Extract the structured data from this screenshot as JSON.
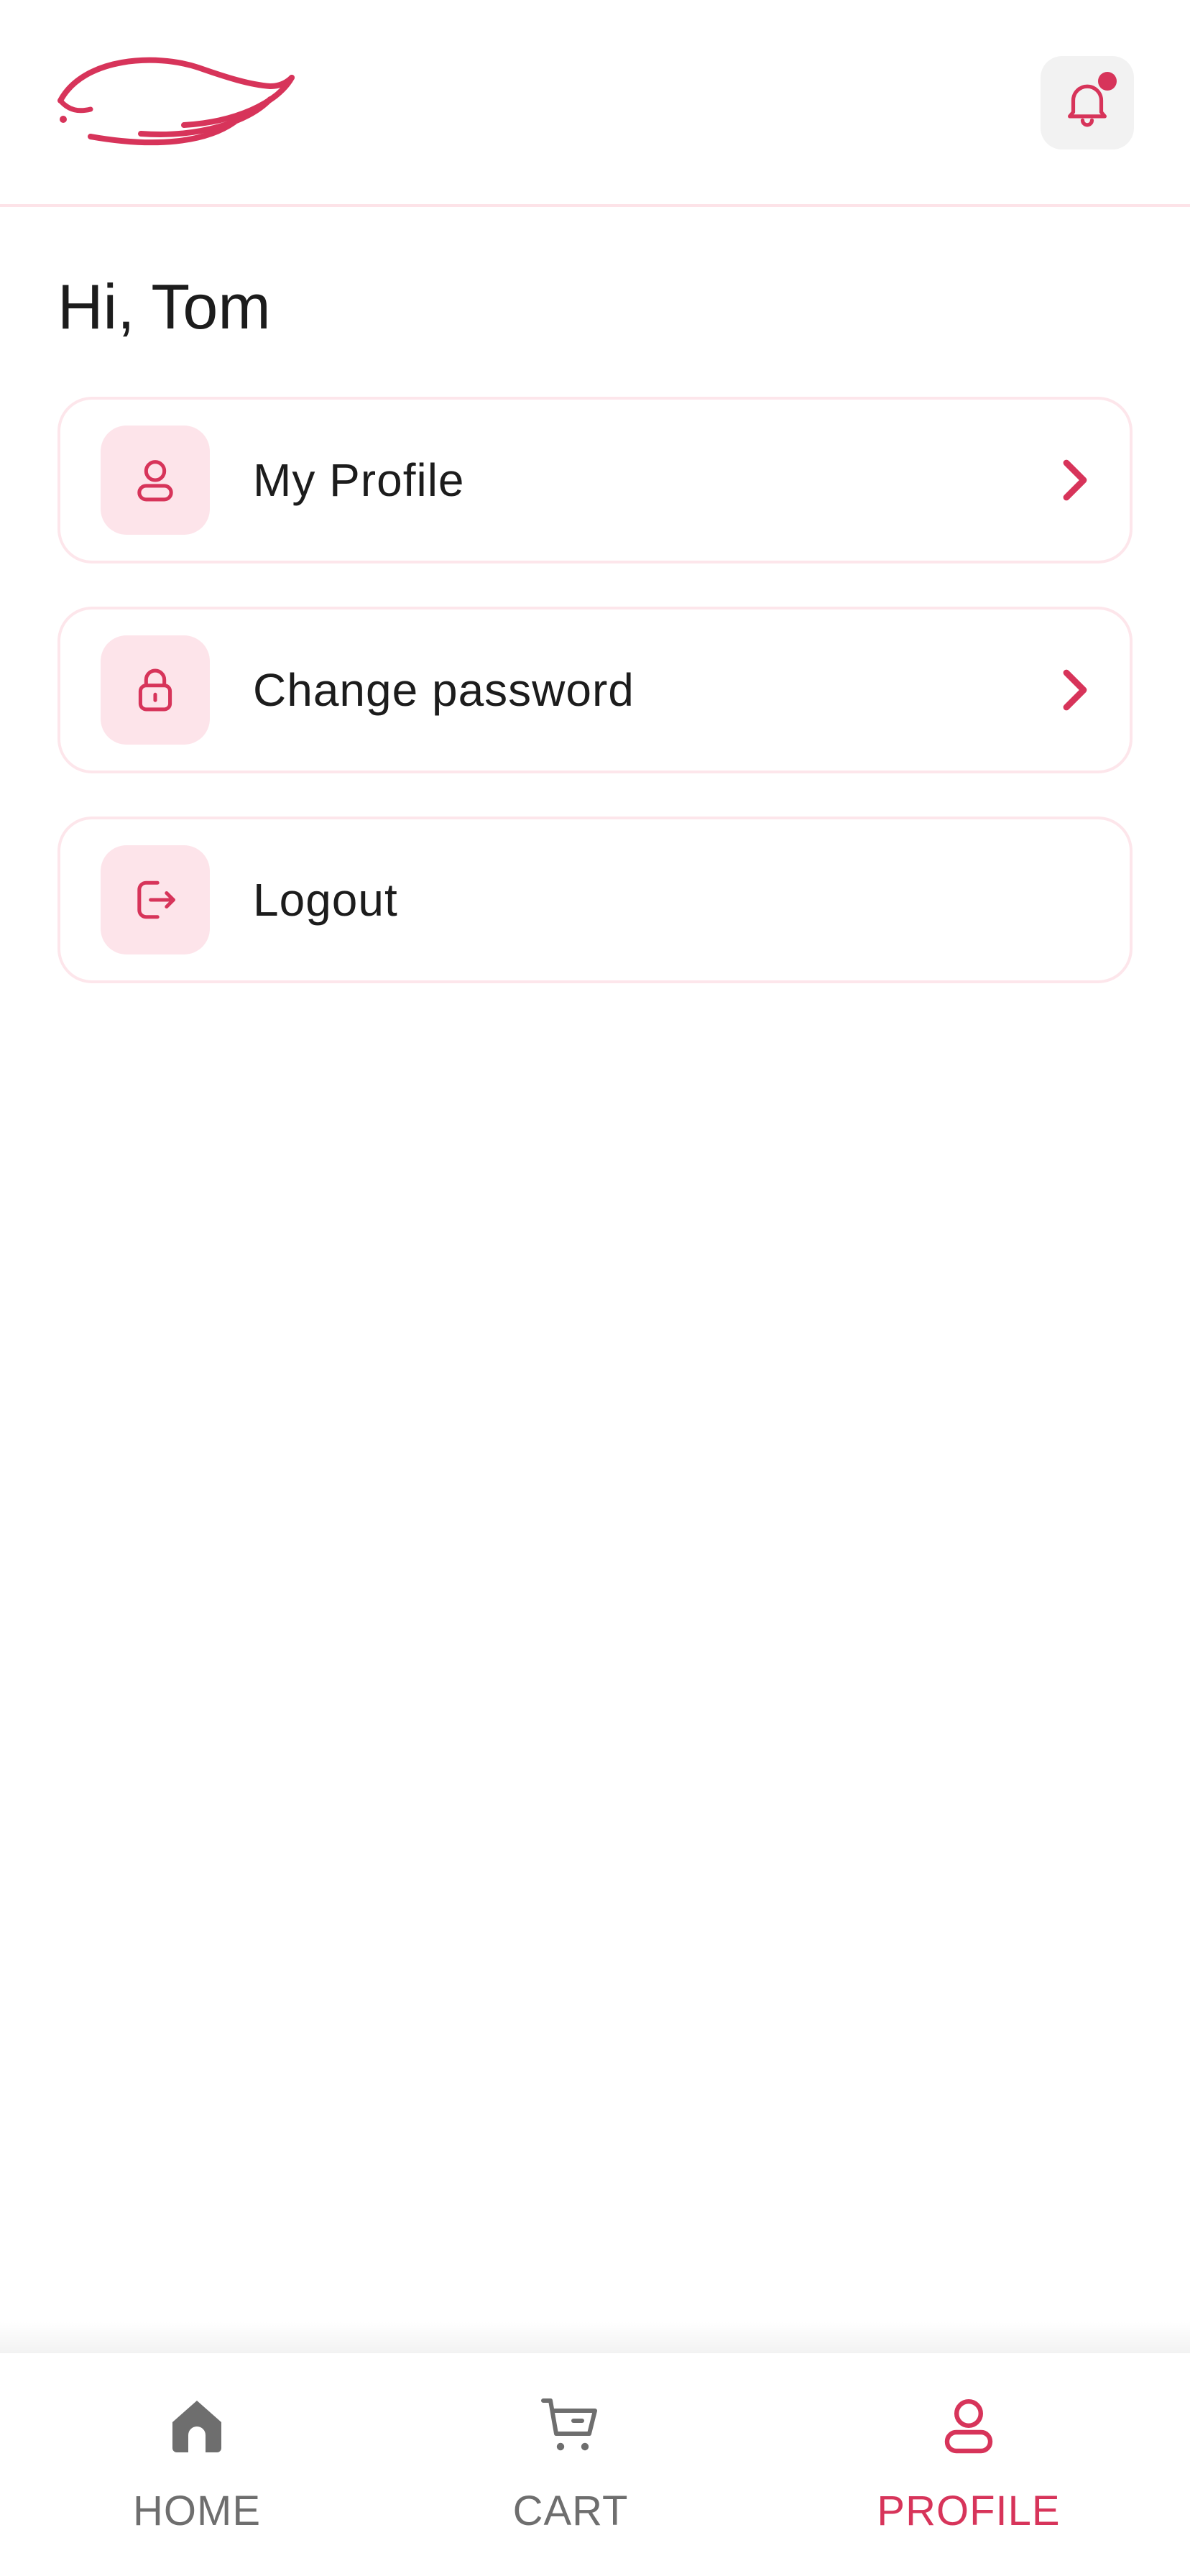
{
  "header": {
    "logo_icon": "wing-logo",
    "notification_icon": "bell-icon",
    "has_unread": true
  },
  "greeting": "Hi, Tom",
  "menu": [
    {
      "label": "My Profile",
      "icon": "user-icon",
      "has_chevron": true
    },
    {
      "label": "Change password",
      "icon": "lock-icon",
      "has_chevron": true
    },
    {
      "label": "Logout",
      "icon": "logout-icon",
      "has_chevron": false
    }
  ],
  "bottom_nav": [
    {
      "label": "HOME",
      "icon": "home-icon",
      "active": false
    },
    {
      "label": "CART",
      "icon": "cart-icon",
      "active": false
    },
    {
      "label": "PROFILE",
      "icon": "user-icon",
      "active": true
    }
  ],
  "colors": {
    "accent": "#d7345a",
    "icon_bg": "#fde4ea",
    "border": "#fde6eb",
    "muted": "#6e6e6e",
    "text": "#1c1c1c"
  }
}
